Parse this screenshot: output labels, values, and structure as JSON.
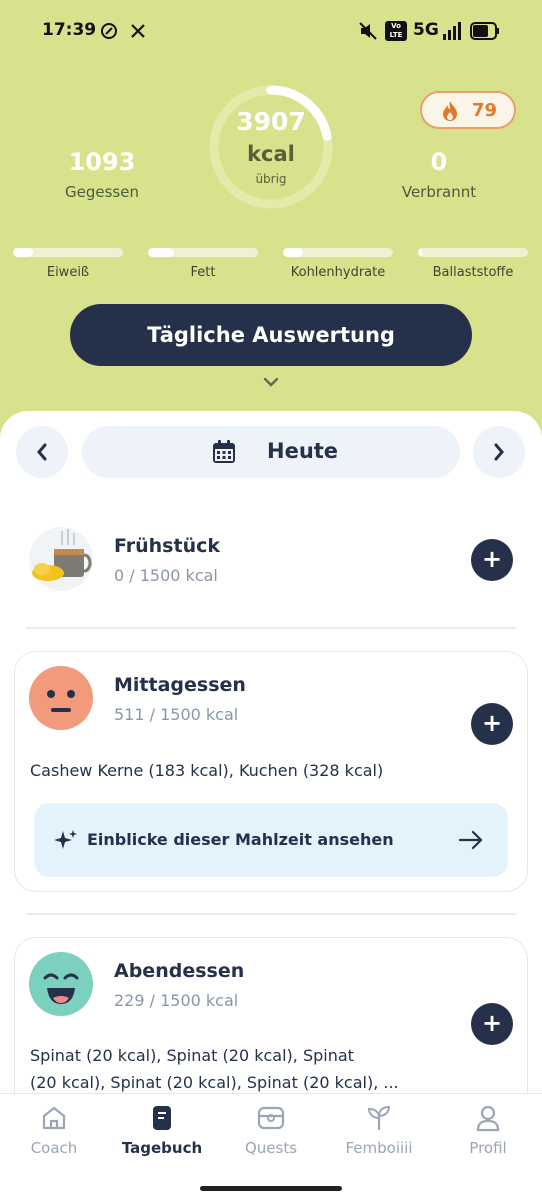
{
  "status_bar": {
    "time": "17:39",
    "network": "5G",
    "icons": [
      "app-notification-icon",
      "x-logo-icon",
      "mute-icon",
      "volte-icon",
      "signal-icon",
      "battery-icon"
    ],
    "volte_label": "Vo LTE"
  },
  "summary": {
    "eaten_value": "1093",
    "eaten_label": "Gegessen",
    "remaining_value": "3907",
    "remaining_unit": "kcal",
    "remaining_label": "übrig",
    "remaining_ring_fraction": 0.22,
    "burned_value": "0",
    "burned_label": "Verbrannt",
    "streak_value": "79"
  },
  "macros": [
    {
      "label": "Eiweiß",
      "fraction": 0.18
    },
    {
      "label": "Fett",
      "fraction": 0.24
    },
    {
      "label": "Kohlenhydrate",
      "fraction": 0.18
    },
    {
      "label": "Ballaststoffe",
      "fraction": 0.04
    }
  ],
  "daily_button": "Tägliche Auswertung",
  "date_nav": {
    "label": "Heute"
  },
  "meals": {
    "breakfast": {
      "title": "Frühstück",
      "kcal": "0 / 1500 kcal"
    },
    "lunch": {
      "title": "Mittagessen",
      "kcal": "511 / 1500 kcal",
      "foods": "Cashew Kerne (183 kcal), Kuchen (328 kcal)",
      "insight": "Einblicke dieser Mahlzeit ansehen"
    },
    "dinner": {
      "title": "Abendessen",
      "kcal": "229 / 1500 kcal",
      "foods_line1": "Spinat (20 kcal), Spinat (20 kcal), Spinat",
      "foods_line2": "(20 kcal), Spinat (20 kcal), Spinat (20 kcal), ..."
    }
  },
  "bottom_nav": [
    {
      "label": "Coach",
      "icon": "home-icon"
    },
    {
      "label": "Tagebuch",
      "icon": "diary-icon"
    },
    {
      "label": "Quests",
      "icon": "chest-icon"
    },
    {
      "label": "Femboiiii",
      "icon": "sprout-icon"
    },
    {
      "label": "Profil",
      "icon": "profile-icon"
    }
  ],
  "colors": {
    "header_bg": "#d8e28c",
    "primary_dark": "#25314a",
    "streak_orange": "#e07a2f",
    "insight_bg": "#e3f2fb"
  }
}
